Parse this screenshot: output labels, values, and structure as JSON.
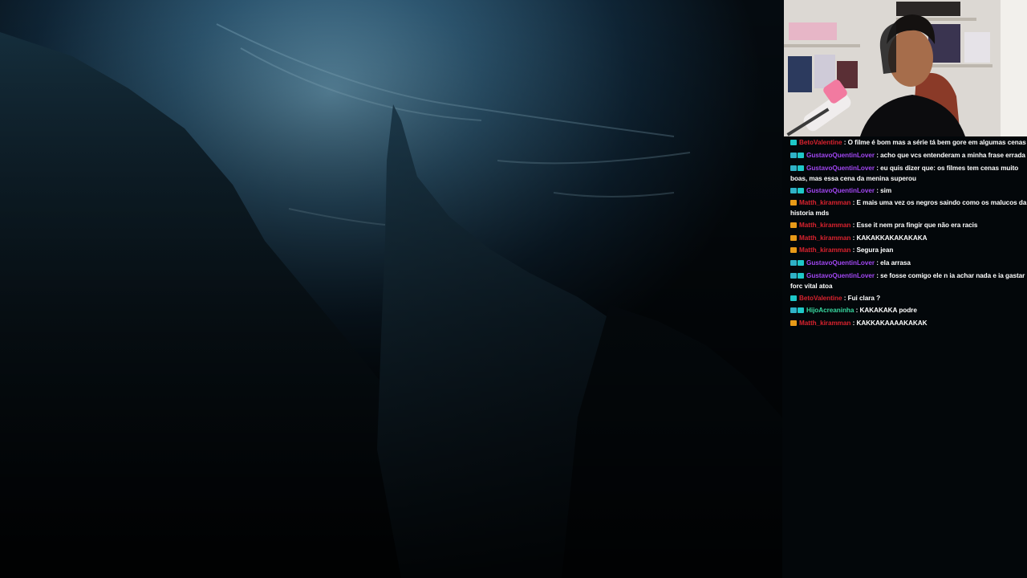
{
  "chat": {
    "colors": {
      "red": "#d8222e",
      "purple": "#a046f0",
      "green": "#38d8a0",
      "badge_cyan": "#2fb2c7",
      "badge_gold": "#e89a18"
    },
    "messages": [
      {
        "user": "BetoValentine",
        "color": "#d8222e",
        "badges": [
          "vip"
        ],
        "text": "O filme é bom mas a série tá bem gore em algumas cenas"
      },
      {
        "user": "GustavoQuentinLover",
        "color": "#a046f0",
        "badges": [
          "sub",
          "vip"
        ],
        "text": "acho que vcs entenderam a minha frase errada"
      },
      {
        "user": "GustavoQuentinLover",
        "color": "#a046f0",
        "badges": [
          "sub",
          "vip"
        ],
        "text": "eu quis dizer que: os filmes tem cenas muito boas, mas essa cena da menina superou"
      },
      {
        "user": "GustavoQuentinLover",
        "color": "#a046f0",
        "badges": [
          "sub",
          "vip"
        ],
        "text": "sim"
      },
      {
        "user": "Matth_kiramman",
        "color": "#d8222e",
        "badges": [
          "crown"
        ],
        "text": "E mais uma vez os negros saindo como os malucos da historia mds"
      },
      {
        "user": "Matth_kiramman",
        "color": "#d8222e",
        "badges": [
          "crown"
        ],
        "text": "Esse it nem pra fingir que não era racis"
      },
      {
        "user": "Matth_kiramman",
        "color": "#d8222e",
        "badges": [
          "crown"
        ],
        "text": "KAKAKKAKAKAKAKA"
      },
      {
        "user": "Matth_kiramman",
        "color": "#d8222e",
        "badges": [
          "crown"
        ],
        "text": "Segura jean"
      },
      {
        "user": "GustavoQuentinLover",
        "color": "#a046f0",
        "badges": [
          "sub",
          "vip"
        ],
        "text": "ela arrasa"
      },
      {
        "user": "GustavoQuentinLover",
        "color": "#a046f0",
        "badges": [
          "sub",
          "vip"
        ],
        "text": "se fosse comigo ele n ia achar nada e ia gastar forc vital atoa"
      },
      {
        "user": "BetoValentine",
        "color": "#d8222e",
        "badges": [
          "vip"
        ],
        "text": "Fui clara ?"
      },
      {
        "user": "HijoAcreaninha",
        "color": "#38d8a0",
        "badges": [
          "sub",
          "vip"
        ],
        "text": "KAKAKAKA podre"
      },
      {
        "user": "Matth_kiramman",
        "color": "#d8222e",
        "badges": [
          "crown"
        ],
        "text": "KAKKAKAAAAKAKAK"
      }
    ]
  }
}
